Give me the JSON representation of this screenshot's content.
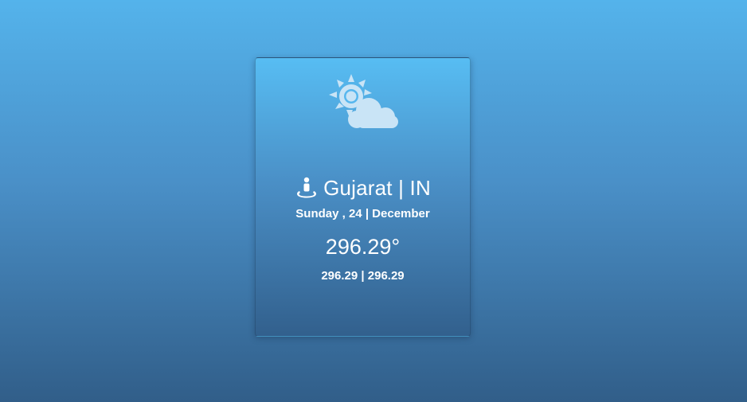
{
  "weather": {
    "icon": "partly-cloudy-icon",
    "location": "Gujarat | IN",
    "location_icon": "location-person-icon",
    "date": "Sunday , 24 | December",
    "temperature": "296.29°",
    "min_max": "296.29 | 296.29"
  },
  "colors": {
    "background_top": "#54b3eb",
    "background_bottom": "#315e89",
    "card_top": "#57bdf3",
    "card_bottom": "#32608d",
    "icon_fill": "#c9e4f6",
    "text": "#ffffff"
  }
}
